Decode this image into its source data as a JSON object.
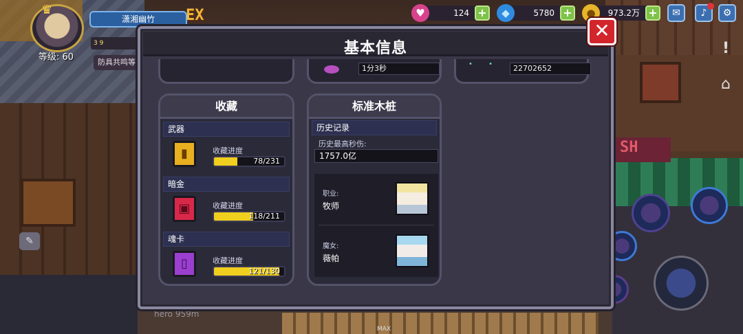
{
  "hud": {
    "player_name": "潇湘幽竹",
    "level": "等级: 60",
    "ex_badge": "EX",
    "stats": "3 9",
    "resonance": "防具共鸣等",
    "hearts": "124",
    "gems": "5780",
    "coins": "973.2万",
    "hero_text": "hero 959m",
    "max_label": "MAX"
  },
  "modal": {
    "title": "基本信息",
    "top_cards": {
      "middle_value": "1分3秒",
      "right_value": "22702652"
    },
    "collection": {
      "title": "收藏",
      "items": [
        {
          "category": "武器",
          "progress_label": "收藏进度",
          "progress_text": "78/231",
          "fraction": 0.338
        },
        {
          "category": "暗金",
          "progress_label": "收藏进度",
          "progress_text": "118/211",
          "fraction": 0.559
        },
        {
          "category": "魂卡",
          "progress_label": "收藏进度",
          "progress_text": "121/130",
          "fraction": 0.931
        }
      ]
    },
    "dummy": {
      "title": "标准木桩",
      "history_header": "历史记录",
      "max_dps_label": "历史最高秒伤:",
      "max_dps_value": "1757.0亿",
      "class_label": "职业:",
      "class_value": "牧师",
      "witch_label": "魔女:",
      "witch_value": "薇帕"
    }
  }
}
